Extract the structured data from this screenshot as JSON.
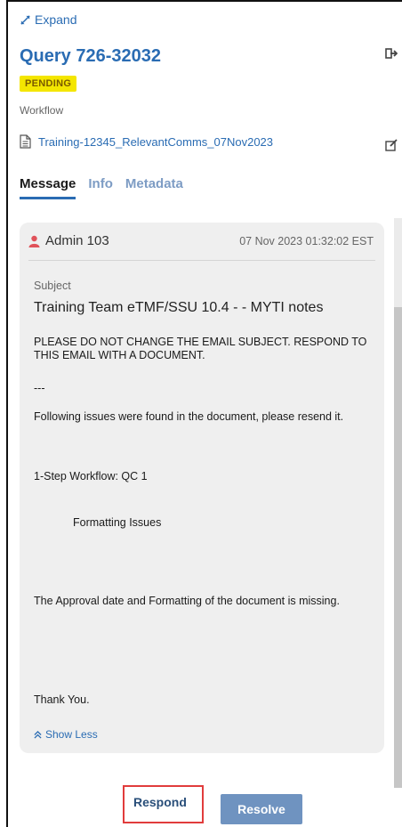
{
  "panel": {
    "expand_label": "Expand",
    "query_title": "Query 726-32032",
    "status_badge": "PENDING",
    "type_label": "Workflow",
    "document_link": "Training-12345_RelevantComms_07Nov2023"
  },
  "tabs": [
    {
      "label": "Message",
      "active": true
    },
    {
      "label": "Info",
      "active": false
    },
    {
      "label": "Metadata",
      "active": false
    }
  ],
  "message": {
    "sender": "Admin 103",
    "timestamp": "07 Nov 2023 01:32:02 EST",
    "subject_label": "Subject",
    "subject": "Training Team eTMF/SSU 10.4 - - MYTI notes",
    "body": [
      "PLEASE DO NOT CHANGE THE EMAIL SUBJECT. RESPOND TO THIS EMAIL WITH A DOCUMENT.",
      "---",
      "Following issues were found in the document, please resend it.",
      "1-Step Workflow: QC 1",
      "Formatting Issues",
      "The Approval date and Formatting of the document is missing.",
      "Thank You."
    ],
    "show_less_label": "Show Less"
  },
  "actions": {
    "respond_label": "Respond",
    "resolve_label": "Resolve"
  },
  "colors": {
    "accent": "#2a6cb3",
    "badge_bg": "#f4e600",
    "highlight": "#e13c3c",
    "sender_icon": "#e0525a"
  },
  "icons": {
    "expand": "expand-arrows-icon",
    "exit": "exit-icon",
    "document": "document-icon",
    "edit": "edit-icon",
    "user": "user-icon",
    "chevron": "double-chevron-up-icon"
  }
}
